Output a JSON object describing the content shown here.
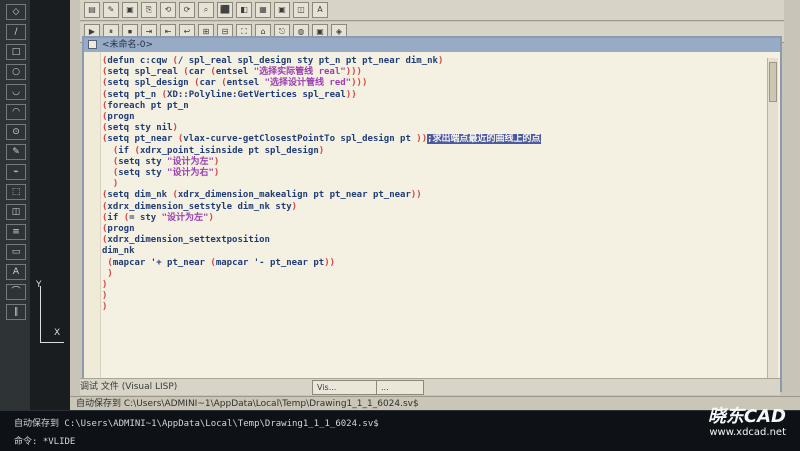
{
  "acad": {
    "toolbar_left": [
      "◇",
      "/",
      "□",
      "○",
      "◡",
      "◠",
      "⊙",
      "✎",
      "⌁",
      "⬚",
      "◫",
      "≡",
      "▭",
      "A",
      "⌒",
      "∥"
    ],
    "ucs": {
      "y": "Y",
      "x": "X"
    }
  },
  "vlide": {
    "toolbar_row1": [
      "▤",
      "✎",
      "▣",
      "⎘",
      "⟲",
      "⟳",
      "⌕",
      "⬛",
      "◧",
      "▦",
      "▣",
      "◫",
      "A"
    ],
    "toolbar_row2": [
      "▶",
      "⏸",
      "⏹",
      "⇥",
      "⇤",
      "↩",
      "⊞",
      "⊟",
      "⛶",
      "⌂",
      "⎋",
      "◍",
      "▣",
      "◈"
    ],
    "editor_title": "<未命名-0>",
    "code_lines": [
      {
        "text": "(defun c:cqw (/ spl_real spl_design sty pt_n pt pt_near dim_nk)"
      },
      {
        "text": "(setq spl_real (car (entsel \"选择实际管线 real\")))"
      },
      {
        "text": "(setq spl_design (car (entsel \"选择设计管线 red\")))"
      },
      {
        "text": "(setq pt_n (XD::Polyline:GetVertices spl_real))"
      },
      {
        "text": "(foreach pt pt_n"
      },
      {
        "text": "(progn"
      },
      {
        "text": "(setq sty nil)"
      },
      {
        "text": "(setq pt_near (vlax-curve-getClosestPointTo spl_design pt ));求出端点最近的曲线上的点"
      },
      {
        "text": "  (if (xdrx_point_isinside pt spl_design)"
      },
      {
        "text": "  (setq sty \"设计为左\")"
      },
      {
        "text": "  (setq sty \"设计为右\")"
      },
      {
        "text": "  )"
      },
      {
        "text": "(setq dim_nk (xdrx_dimension_makealign pt pt_near pt_near))"
      },
      {
        "text": "(xdrx_dimension_setstyle dim_nk sty)"
      },
      {
        "text": "(if (= sty \"设计为左\")"
      },
      {
        "text": "(progn"
      },
      {
        "text": "(xdrx_dimension_settextposition"
      },
      {
        "text": "dim_nk"
      },
      {
        "text": " (mapcar '+ pt_near (mapcar '- pt_near pt))"
      },
      {
        "text": " )"
      },
      {
        "text": ")"
      },
      {
        "text": ")"
      },
      {
        "text": ")"
      }
    ],
    "status_strip_text": "调试    文件    (Visual LISP)",
    "taskbar": [
      "Vis...",
      "..."
    ],
    "status_main": [
      "自动保存到 C:\\Users\\ADMINI~1\\AppData\\Local\\Temp\\Drawing1_1_1_6024.sv$"
    ]
  },
  "command_line": {
    "line1": "自动保存到 C:\\Users\\ADMINI~1\\AppData\\Local\\Temp\\Drawing1_1_1_6024.sv$",
    "line2": "命令: *VLIDE"
  },
  "watermark": {
    "brand": "晓东CAD",
    "url": "www.xdcad.net"
  }
}
